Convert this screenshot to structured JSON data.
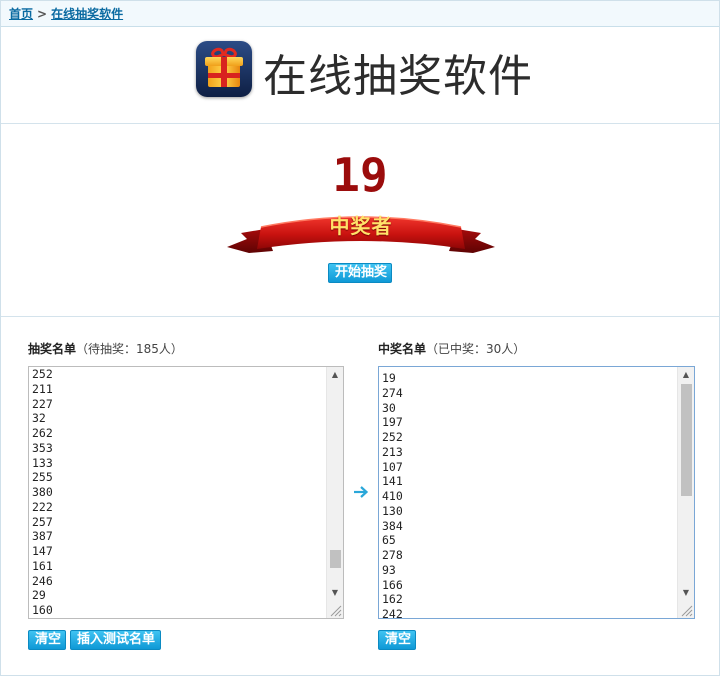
{
  "breadcrumb": {
    "home": "首页",
    "separator": ">",
    "current": "在线抽奖软件"
  },
  "header": {
    "logo_icon": "gift-box-icon",
    "title": "在线抽奖软件"
  },
  "draw": {
    "winner_number": "19",
    "banner_label": "中奖者",
    "start_button": "开始抽奖"
  },
  "pool": {
    "title": "抽奖名单",
    "note": "（待抽奖：185人）",
    "items": [
      "252",
      "211",
      "227",
      "32",
      "262",
      "353",
      "133",
      "255",
      "380",
      "222",
      "257",
      "387",
      "147",
      "161",
      "246",
      "29",
      "160"
    ],
    "scroll_position": 0.9,
    "clear_button": "清空",
    "insert_button": "插入测试名单"
  },
  "winners": {
    "title": "中奖名单",
    "note": "（已中奖：30人）",
    "items": [
      "19",
      "274",
      "30",
      "197",
      "252",
      "213",
      "107",
      "141",
      "410",
      "130",
      "384",
      "65",
      "278",
      "93",
      "166",
      "162",
      "242"
    ],
    "scroll_position": 0.0,
    "clear_button": "清空"
  },
  "colors": {
    "accent": "#1aa6e2",
    "winner_number": "#9b0c0c",
    "banner_red": "#d31b16",
    "banner_text": "#ffe26a",
    "link": "#0a6aa1"
  }
}
